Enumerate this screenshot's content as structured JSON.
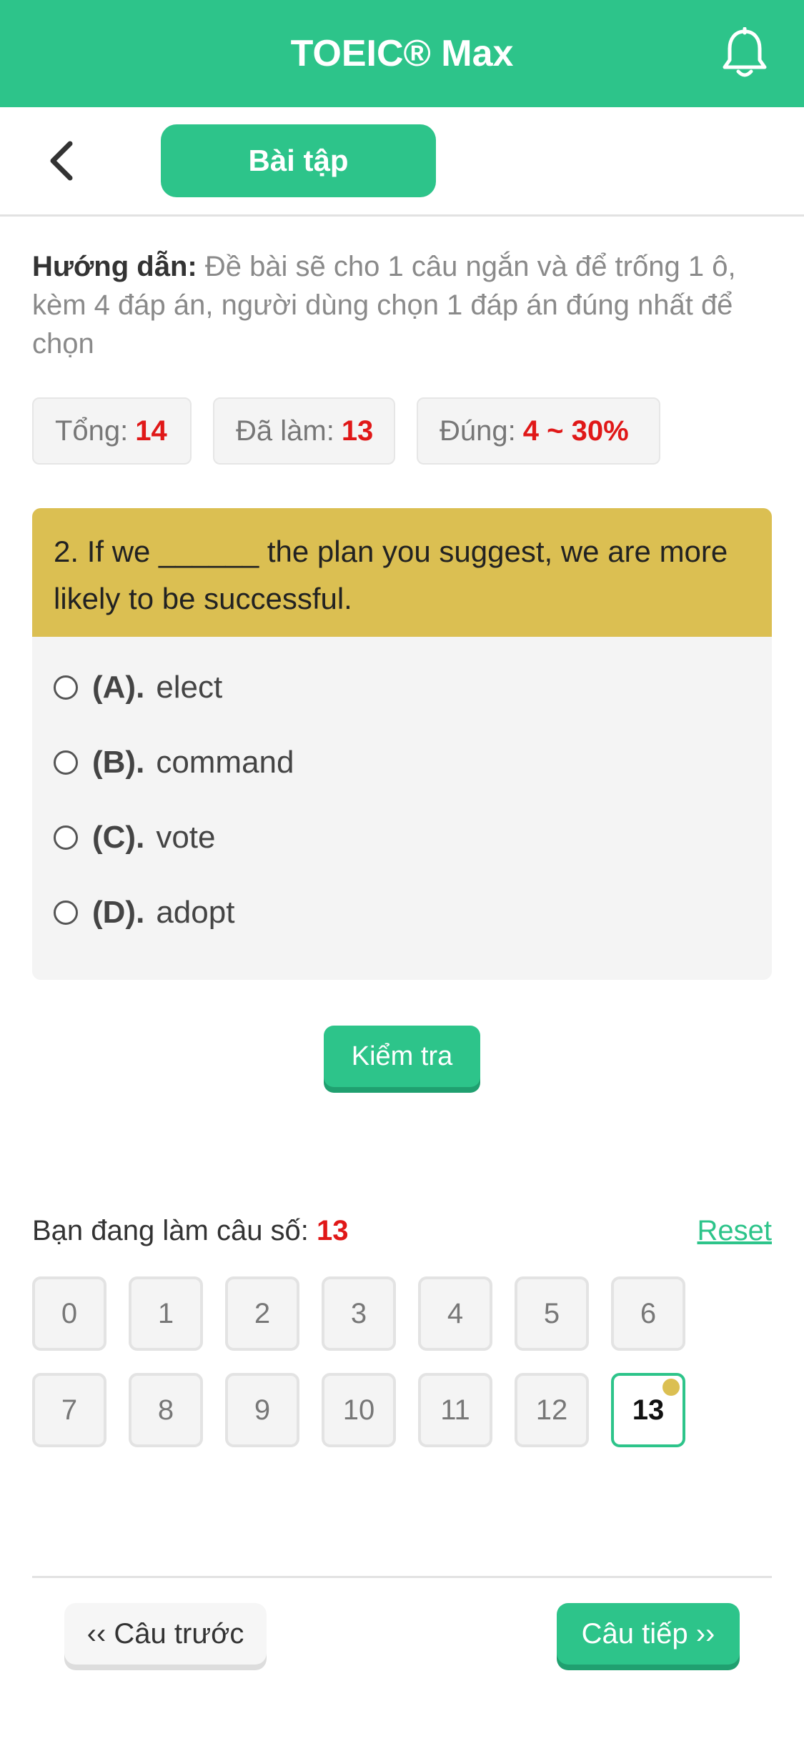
{
  "header": {
    "title": "TOEIC® Max",
    "bell_icon": "bell-icon",
    "accent_color": "#2dc48a"
  },
  "subheader": {
    "back_icon": "chevron-left-icon",
    "tab_label": "Bài tập"
  },
  "instructions": {
    "lead": "Hướng dẫn:",
    "text": " Đề bài sẽ cho 1 câu ngắn và để trống 1 ô, kèm 4 đáp án, người dùng chọn 1 đáp án đúng nhất để chọn"
  },
  "stats": {
    "total_label": "Tổng:",
    "total_value": "14",
    "done_label": "Đã làm:",
    "done_value": "13",
    "correct_label": "Đúng:",
    "correct_value": "4 ~ 30%"
  },
  "question": {
    "text": "2. If we ______ the plan you suggest, we are more likely to be successful.",
    "options": [
      {
        "letter": "(A).",
        "text": "elect"
      },
      {
        "letter": "(B).",
        "text": "command"
      },
      {
        "letter": "(C).",
        "text": "vote"
      },
      {
        "letter": "(D).",
        "text": "adopt"
      }
    ]
  },
  "check_button": "Kiểm tra",
  "progress": {
    "label": "Bạn đang làm câu số:",
    "current": "13",
    "reset": "Reset"
  },
  "numbers": [
    "0",
    "1",
    "2",
    "3",
    "4",
    "5",
    "6",
    "7",
    "8",
    "9",
    "10",
    "11",
    "12",
    "13"
  ],
  "nav": {
    "prev": "‹‹ Câu trước",
    "next": "Câu tiếp ››"
  }
}
